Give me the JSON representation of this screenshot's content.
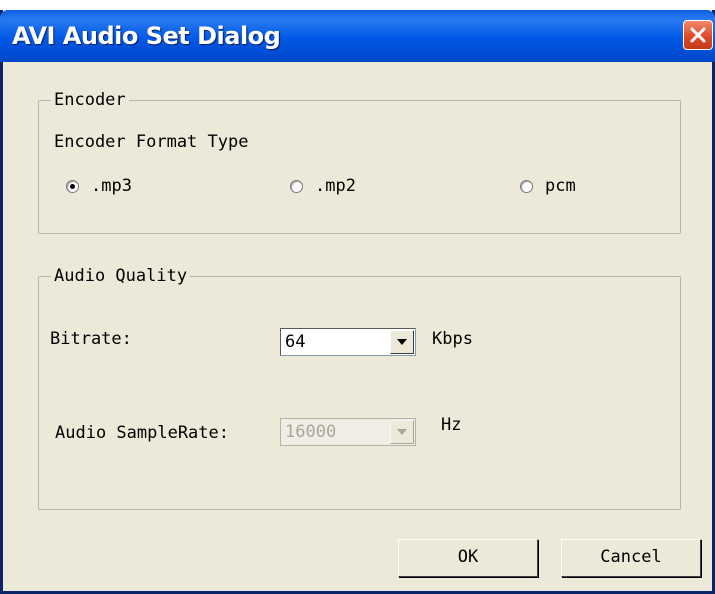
{
  "window": {
    "title": "AVI Audio Set Dialog"
  },
  "encoder": {
    "group_label": "Encoder",
    "format_label": "Encoder Format Type",
    "options": [
      {
        "label": ".mp3",
        "checked": true
      },
      {
        "label": ".mp2",
        "checked": false
      },
      {
        "label": "pcm",
        "checked": false
      }
    ]
  },
  "audio_quality": {
    "group_label": "Audio Quality",
    "bitrate_label": "Bitrate:",
    "bitrate_value": "64",
    "bitrate_unit": "Kbps",
    "samplerate_label": "Audio SampleRate:",
    "samplerate_value": "16000",
    "samplerate_unit": "Hz",
    "samplerate_disabled": true
  },
  "buttons": {
    "ok_label": "OK",
    "cancel_label": "Cancel"
  },
  "colors": {
    "titlebar": "#0058e6",
    "close": "#e0492a",
    "face": "#ece9d8"
  }
}
